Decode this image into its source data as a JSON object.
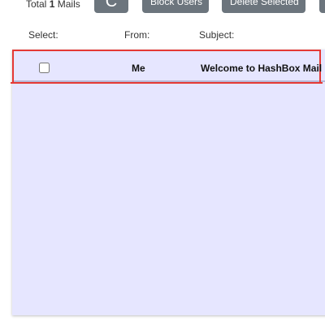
{
  "toolbar": {
    "total_prefix": "Total",
    "total_count": "1",
    "total_suffix": "Mails",
    "refresh_icon": "refresh-icon",
    "refresh_glyph": "C",
    "block_users_label": "Block Users",
    "delete_selected_label": "Delete Selected"
  },
  "columns": {
    "select": "Select:",
    "from": "From:",
    "subject": "Subject:"
  },
  "mails": [
    {
      "from": "Me",
      "subject": "Welcome to HashBox Mail",
      "selected": false
    }
  ],
  "colors": {
    "button_bg": "#6c757d",
    "panel_bg": "#e6e6ff",
    "highlight_border": "#e53935"
  }
}
